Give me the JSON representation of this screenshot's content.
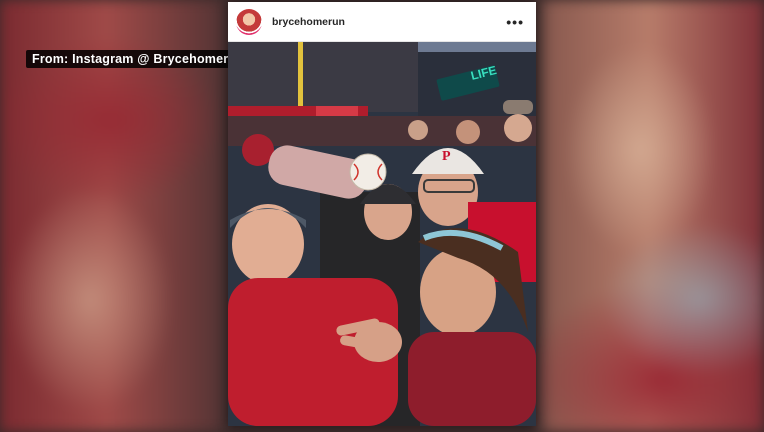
{
  "overlay": {
    "source_tag": "From: Instagram @ Brycehomerun"
  },
  "post": {
    "username": "brycehomerun",
    "more_icon": "more-options-icon",
    "photo_sign_text": "LIFE"
  },
  "colors": {
    "phillies_red": "#c8102e",
    "sky": "#5c6b86",
    "sign_green": "#39e0c0"
  }
}
